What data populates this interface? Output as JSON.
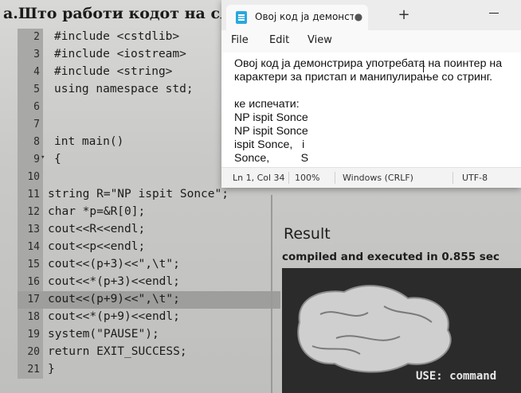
{
  "photo": {
    "heading": "а.Што работи кодот на сл",
    "code": [
      {
        "n": "2",
        "text": "#include <cstdlib>"
      },
      {
        "n": "3",
        "text": "#include <iostream>"
      },
      {
        "n": "4",
        "text": "#include <string>"
      },
      {
        "n": "5",
        "text": "using namespace std;"
      },
      {
        "n": "6",
        "text": ""
      },
      {
        "n": "7",
        "text": ""
      },
      {
        "n": "8",
        "text": "int main()"
      },
      {
        "n": "9",
        "text": "{"
      },
      {
        "n": "10",
        "text": ""
      },
      {
        "n": "11",
        "text": "string R=\"NP ispit Sonce\";"
      },
      {
        "n": "12",
        "text": "char *p=&R[0];"
      },
      {
        "n": "13",
        "text": "cout<<R<<endl;"
      },
      {
        "n": "14",
        "text": "cout<<p<<endl;"
      },
      {
        "n": "15",
        "text": "cout<<(p+3)<<\",\\t\";"
      },
      {
        "n": "16",
        "text": "cout<<*(p+3)<<endl;"
      },
      {
        "n": "17",
        "text": "cout<<(p+9)<<\",\\t\";"
      },
      {
        "n": "18",
        "text": "cout<<*(p+9)<<endl;"
      },
      {
        "n": "19",
        "text": "system(\"PAUSE\");"
      },
      {
        "n": "20",
        "text": "return EXIT_SUCCESS;"
      },
      {
        "n": "21",
        "text": "}"
      }
    ],
    "fold_marker": "▾",
    "result_title": "Result",
    "result_compiled": "compiled and executed in 0.855 sec",
    "console_text": "USE: command"
  },
  "notepad": {
    "tab_title": "Овој код ја демонстри",
    "tab_close": "●",
    "new_tab": "+",
    "menu": {
      "file": "File",
      "edit": "Edit",
      "view": "View"
    },
    "content": "Овој код ја демонстрира употребата на поинтер на\nкарактери за пристап и манипулирање со стринг.\n\nке испечати:\nNP ispit Sonce\nNP ispit Sonce\nispit Sonce,   i\nSonce,          S",
    "status": {
      "position": "Ln 1, Col 34",
      "zoom": "100%",
      "line_ending": "Windows (CRLF)",
      "encoding": "UTF-8"
    }
  }
}
